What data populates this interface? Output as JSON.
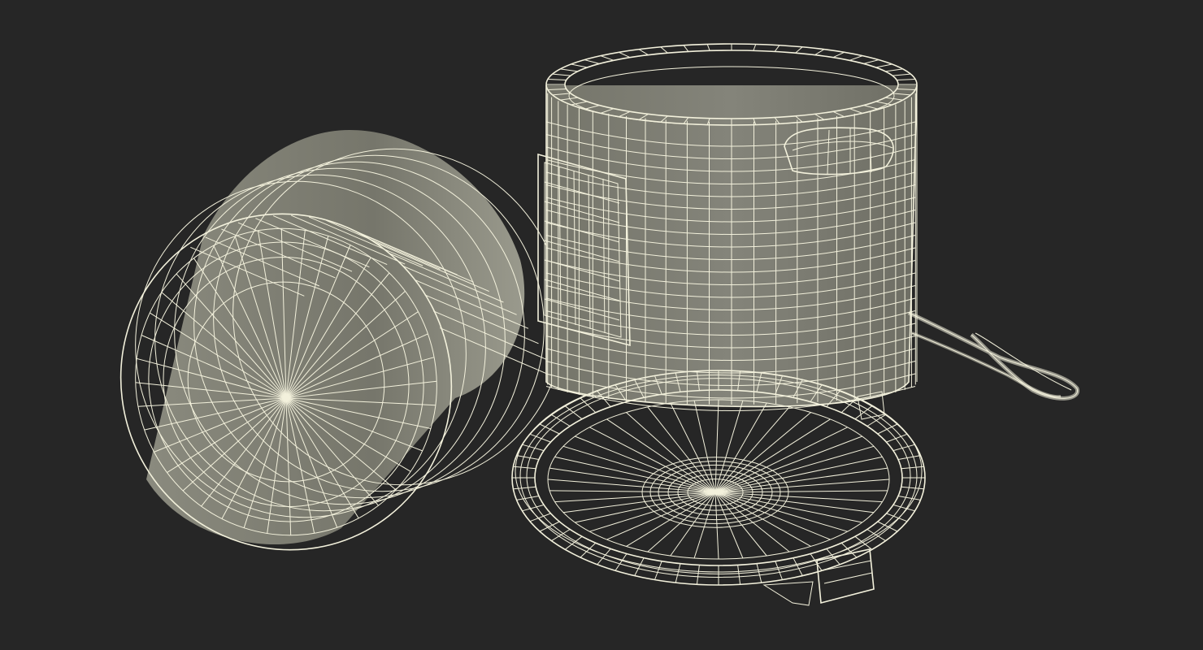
{
  "scene": {
    "background": "#262626",
    "mesh_fill": "#7d7d72",
    "wire_color": "#f3f1dc",
    "objects": [
      "inner-pot-on-side",
      "cooker-base",
      "power-cord",
      "lid-open-on-floor"
    ]
  }
}
